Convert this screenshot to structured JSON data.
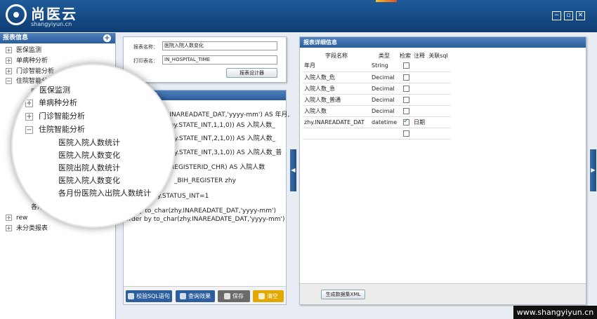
{
  "header": {
    "logo_name": "尚医云",
    "logo_url": "shangyiyun.cn",
    "controls": [
      "minimize-icon",
      "restore-icon",
      "close-icon"
    ],
    "colors": {
      "header": "#0e3d73",
      "panel_head": "#2a5d9a"
    }
  },
  "sidebar": {
    "title": "报表信息",
    "add_icon": "plus-circle-icon",
    "items": [
      {
        "label": "医保监测",
        "toggle": "+"
      },
      {
        "label": "单病种分析",
        "toggle": "+"
      },
      {
        "label": "门诊智能分析",
        "toggle": "+"
      },
      {
        "label": "住院智能分",
        "toggle": "−"
      },
      {
        "label": "医",
        "toggle": ""
      },
      {
        "label": "各月份",
        "toggle": ""
      },
      {
        "label": "rew",
        "toggle": "+"
      },
      {
        "label": "未分类报表",
        "toggle": "+"
      }
    ]
  },
  "magnifier": {
    "items": [
      {
        "label": "医保监测",
        "toggle": ""
      },
      {
        "label": "单病种分析",
        "toggle": "+"
      },
      {
        "label": "门诊智能分析",
        "toggle": "+"
      },
      {
        "label": "住院智能分析",
        "toggle": "−"
      },
      {
        "label": "医院入院人数统计",
        "toggle": ""
      },
      {
        "label": "医院入院人数变化",
        "toggle": ""
      },
      {
        "label": "医院出院人数统计",
        "toggle": ""
      },
      {
        "label": "医院入院人数变化",
        "toggle": ""
      },
      {
        "label": "各月份医院入出院人数统计",
        "toggle": ""
      }
    ]
  },
  "form": {
    "report_name_label": "报表名称：",
    "report_name_value": "医院入院人数变化",
    "print_label": "打印表名：",
    "print_value": "IN_HOSPITAL_TIME",
    "designer_button": "报表设计器"
  },
  "sql": {
    "title": "句",
    "lines": [
      "zhy.INAREADATE_DAT,'yyyy-mm') AS 年月,",
      "e(zhy.STATE_INT,1,1,0)) AS 入院人数_",
      "(zhy.STATE_INT,2,1,0)) AS 入院人数_",
      "(zhy.STATE_INT,3,1,0)) AS 入院人数_普",
      "REGISTERID_CHR) AS 入院人数",
      "_BIH_REGISTER zhy",
      "y.STATUS_INT=1",
      "up by to_char(zhy.INAREADATE_DAT,'yyyy-mm')",
      "order by to_char(zhy.INAREADATE_DAT,'yyyy-mm')"
    ],
    "buttons": [
      {
        "label": "校验SQL语句",
        "icon": "hand-pointer-icon",
        "color": "#2d5f9e"
      },
      {
        "label": "查询效果",
        "icon": "refresh-icon",
        "color": "#2d5f9e"
      },
      {
        "label": "保存",
        "icon": "save-icon",
        "color": "#6a6a6a"
      },
      {
        "label": "清空",
        "icon": "trash-icon",
        "color": "#e0a800"
      }
    ]
  },
  "detail": {
    "title": "报表详细信息",
    "columns": [
      "字段名称",
      "类型",
      "检索",
      "注释",
      "关联sql"
    ],
    "rows": [
      {
        "name": "年月",
        "type": "String",
        "search": false,
        "note": ""
      },
      {
        "name": "入院人数_危",
        "type": "Decimal",
        "search": false,
        "note": ""
      },
      {
        "name": "入院人数_急",
        "type": "Decimal",
        "search": false,
        "note": ""
      },
      {
        "name": "入院人数_普通",
        "type": "Decimal",
        "search": false,
        "note": ""
      },
      {
        "name": "入院人数",
        "type": "Decimal",
        "search": false,
        "note": ""
      },
      {
        "name": "zhy.INAREADATE_DAT",
        "type": "datetime",
        "search": true,
        "note": "日期"
      },
      {
        "name": "",
        "type": "",
        "search": false,
        "note": ""
      }
    ],
    "generate_button": "生成数据集XML"
  },
  "watermark": "www.shangyiyun.cn"
}
